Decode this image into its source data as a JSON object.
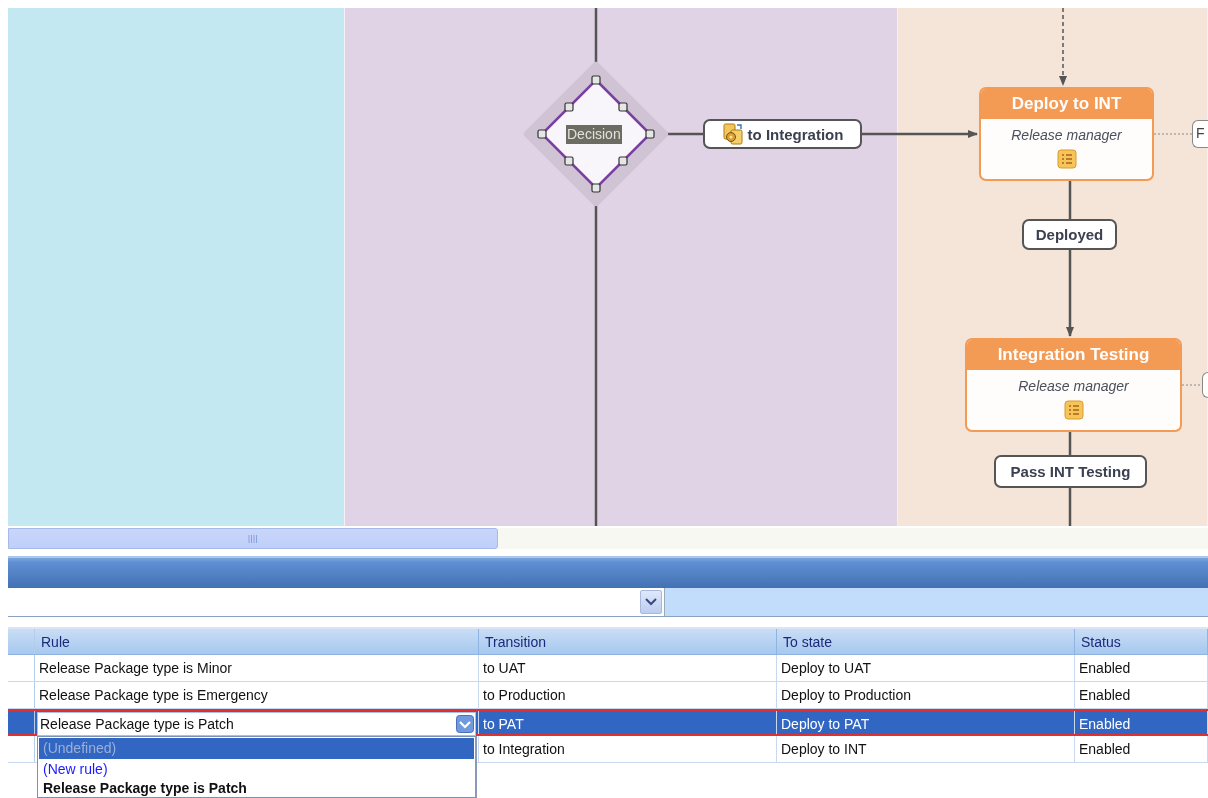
{
  "diagram": {
    "lanes": [
      {
        "color": "#c4e8f2"
      },
      {
        "color": "#e0d3e6"
      },
      {
        "color": "#f5e4d8"
      }
    ],
    "decision": {
      "label": "Decision",
      "selected": true
    },
    "transitions": [
      {
        "label": "to Integration",
        "kind": "rule"
      },
      {
        "label": "Deployed",
        "kind": "plain"
      },
      {
        "label": "Pass INT Testing",
        "kind": "plain"
      }
    ],
    "states": [
      {
        "title": "Deploy to INT",
        "role": "Release manager"
      },
      {
        "title": "Integration Testing",
        "role": "Release manager"
      }
    ],
    "cut_label": "F"
  },
  "grid": {
    "columns": [
      "Rule",
      "Transition",
      "To state",
      "Status"
    ],
    "rows": [
      {
        "cells": [
          "Release Package type is Minor",
          "to UAT",
          "Deploy to UAT",
          "Enabled"
        ],
        "selected": false
      },
      {
        "cells": [
          "Release Package type is Emergency",
          "to Production",
          "Deploy to Production",
          "Enabled"
        ],
        "selected": false
      },
      {
        "cells": [
          "Release Package type is Patch",
          "to PAT",
          "Deploy to PAT",
          "Enabled"
        ],
        "selected": true
      },
      {
        "cells": [
          "",
          "to Integration",
          "Deploy to INT",
          "Enabled"
        ],
        "selected": false
      }
    ]
  },
  "dropdown": {
    "items": [
      {
        "label": "(Undefined)",
        "kind": "undefined",
        "selected": true
      },
      {
        "label": "(New rule)",
        "kind": "new",
        "selected": false
      },
      {
        "label": "Release Package type is Patch",
        "kind": "current",
        "selected": false
      }
    ]
  }
}
